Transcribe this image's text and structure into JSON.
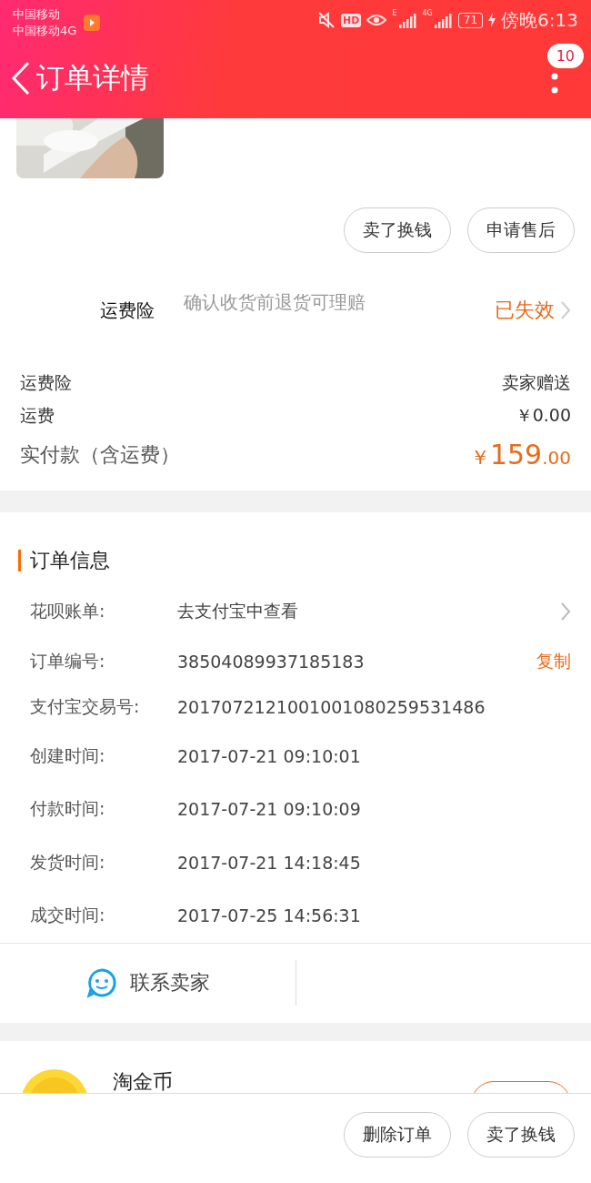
{
  "status_bar": {
    "carrier_1": "中国移动",
    "carrier_2": "中国移动4G",
    "hd": "HD",
    "network_1": "E",
    "network_2": "4G",
    "battery": "71",
    "time": "傍晚6:13"
  },
  "header": {
    "title": "订单详情",
    "badge": "10"
  },
  "order_actions": [
    {
      "label": "卖了换钱"
    },
    {
      "label": "申请售后"
    }
  ],
  "insurance": {
    "label": "运费险",
    "description": "确认收货前退货可理赔",
    "status": "已失效"
  },
  "costs": [
    {
      "label": "运费险",
      "value": "卖家赠送"
    },
    {
      "label": "运费",
      "value": "￥0.00"
    }
  ],
  "total": {
    "label": "实付款（含运费）",
    "currency": "￥",
    "integer": "159",
    "decimal": ".00"
  },
  "order_info": {
    "title": "订单信息",
    "rows": [
      {
        "label": "花呗账单:",
        "value": "去支付宝中查看",
        "kind": "link"
      },
      {
        "label": "订单编号:",
        "value": "38504089937185183",
        "kind": "copy",
        "action": "复制"
      },
      {
        "label": "支付宝交易号:",
        "value": "2017072121001001080259531486",
        "kind": "plain"
      },
      {
        "label": "创建时间:",
        "value": "2017-07-21 09:10:01",
        "kind": "plain"
      },
      {
        "label": "付款时间:",
        "value": "2017-07-21 09:10:09",
        "kind": "plain"
      },
      {
        "label": "发货时间:",
        "value": "2017-07-21 14:18:45",
        "kind": "plain"
      },
      {
        "label": "成交时间:",
        "value": "2017-07-25 14:56:31",
        "kind": "plain"
      }
    ]
  },
  "contact": {
    "label": "联系卖家"
  },
  "coins": {
    "title": "淘金币"
  },
  "bottom_actions": [
    {
      "label": "删除订单"
    },
    {
      "label": "卖了换钱"
    }
  ]
}
